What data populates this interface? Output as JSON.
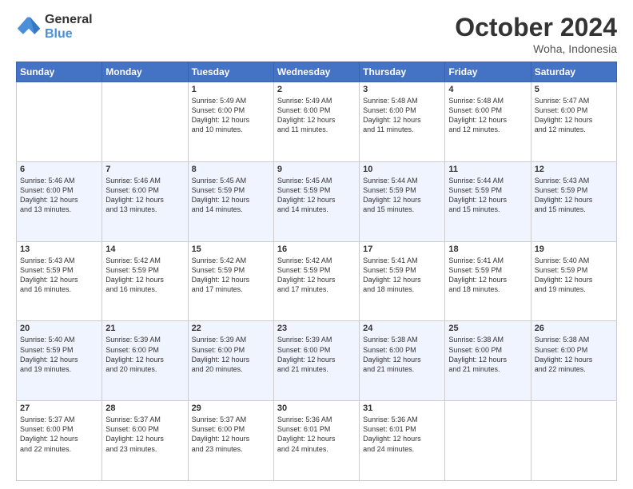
{
  "logo": {
    "general": "General",
    "blue": "Blue"
  },
  "header": {
    "month": "October 2024",
    "location": "Woha, Indonesia"
  },
  "days": [
    "Sunday",
    "Monday",
    "Tuesday",
    "Wednesday",
    "Thursday",
    "Friday",
    "Saturday"
  ],
  "weeks": [
    [
      {
        "day": "",
        "lines": []
      },
      {
        "day": "",
        "lines": []
      },
      {
        "day": "1",
        "lines": [
          "Sunrise: 5:49 AM",
          "Sunset: 6:00 PM",
          "Daylight: 12 hours",
          "and 10 minutes."
        ]
      },
      {
        "day": "2",
        "lines": [
          "Sunrise: 5:49 AM",
          "Sunset: 6:00 PM",
          "Daylight: 12 hours",
          "and 11 minutes."
        ]
      },
      {
        "day": "3",
        "lines": [
          "Sunrise: 5:48 AM",
          "Sunset: 6:00 PM",
          "Daylight: 12 hours",
          "and 11 minutes."
        ]
      },
      {
        "day": "4",
        "lines": [
          "Sunrise: 5:48 AM",
          "Sunset: 6:00 PM",
          "Daylight: 12 hours",
          "and 12 minutes."
        ]
      },
      {
        "day": "5",
        "lines": [
          "Sunrise: 5:47 AM",
          "Sunset: 6:00 PM",
          "Daylight: 12 hours",
          "and 12 minutes."
        ]
      }
    ],
    [
      {
        "day": "6",
        "lines": [
          "Sunrise: 5:46 AM",
          "Sunset: 6:00 PM",
          "Daylight: 12 hours",
          "and 13 minutes."
        ]
      },
      {
        "day": "7",
        "lines": [
          "Sunrise: 5:46 AM",
          "Sunset: 6:00 PM",
          "Daylight: 12 hours",
          "and 13 minutes."
        ]
      },
      {
        "day": "8",
        "lines": [
          "Sunrise: 5:45 AM",
          "Sunset: 5:59 PM",
          "Daylight: 12 hours",
          "and 14 minutes."
        ]
      },
      {
        "day": "9",
        "lines": [
          "Sunrise: 5:45 AM",
          "Sunset: 5:59 PM",
          "Daylight: 12 hours",
          "and 14 minutes."
        ]
      },
      {
        "day": "10",
        "lines": [
          "Sunrise: 5:44 AM",
          "Sunset: 5:59 PM",
          "Daylight: 12 hours",
          "and 15 minutes."
        ]
      },
      {
        "day": "11",
        "lines": [
          "Sunrise: 5:44 AM",
          "Sunset: 5:59 PM",
          "Daylight: 12 hours",
          "and 15 minutes."
        ]
      },
      {
        "day": "12",
        "lines": [
          "Sunrise: 5:43 AM",
          "Sunset: 5:59 PM",
          "Daylight: 12 hours",
          "and 15 minutes."
        ]
      }
    ],
    [
      {
        "day": "13",
        "lines": [
          "Sunrise: 5:43 AM",
          "Sunset: 5:59 PM",
          "Daylight: 12 hours",
          "and 16 minutes."
        ]
      },
      {
        "day": "14",
        "lines": [
          "Sunrise: 5:42 AM",
          "Sunset: 5:59 PM",
          "Daylight: 12 hours",
          "and 16 minutes."
        ]
      },
      {
        "day": "15",
        "lines": [
          "Sunrise: 5:42 AM",
          "Sunset: 5:59 PM",
          "Daylight: 12 hours",
          "and 17 minutes."
        ]
      },
      {
        "day": "16",
        "lines": [
          "Sunrise: 5:42 AM",
          "Sunset: 5:59 PM",
          "Daylight: 12 hours",
          "and 17 minutes."
        ]
      },
      {
        "day": "17",
        "lines": [
          "Sunrise: 5:41 AM",
          "Sunset: 5:59 PM",
          "Daylight: 12 hours",
          "and 18 minutes."
        ]
      },
      {
        "day": "18",
        "lines": [
          "Sunrise: 5:41 AM",
          "Sunset: 5:59 PM",
          "Daylight: 12 hours",
          "and 18 minutes."
        ]
      },
      {
        "day": "19",
        "lines": [
          "Sunrise: 5:40 AM",
          "Sunset: 5:59 PM",
          "Daylight: 12 hours",
          "and 19 minutes."
        ]
      }
    ],
    [
      {
        "day": "20",
        "lines": [
          "Sunrise: 5:40 AM",
          "Sunset: 5:59 PM",
          "Daylight: 12 hours",
          "and 19 minutes."
        ]
      },
      {
        "day": "21",
        "lines": [
          "Sunrise: 5:39 AM",
          "Sunset: 6:00 PM",
          "Daylight: 12 hours",
          "and 20 minutes."
        ]
      },
      {
        "day": "22",
        "lines": [
          "Sunrise: 5:39 AM",
          "Sunset: 6:00 PM",
          "Daylight: 12 hours",
          "and 20 minutes."
        ]
      },
      {
        "day": "23",
        "lines": [
          "Sunrise: 5:39 AM",
          "Sunset: 6:00 PM",
          "Daylight: 12 hours",
          "and 21 minutes."
        ]
      },
      {
        "day": "24",
        "lines": [
          "Sunrise: 5:38 AM",
          "Sunset: 6:00 PM",
          "Daylight: 12 hours",
          "and 21 minutes."
        ]
      },
      {
        "day": "25",
        "lines": [
          "Sunrise: 5:38 AM",
          "Sunset: 6:00 PM",
          "Daylight: 12 hours",
          "and 21 minutes."
        ]
      },
      {
        "day": "26",
        "lines": [
          "Sunrise: 5:38 AM",
          "Sunset: 6:00 PM",
          "Daylight: 12 hours",
          "and 22 minutes."
        ]
      }
    ],
    [
      {
        "day": "27",
        "lines": [
          "Sunrise: 5:37 AM",
          "Sunset: 6:00 PM",
          "Daylight: 12 hours",
          "and 22 minutes."
        ]
      },
      {
        "day": "28",
        "lines": [
          "Sunrise: 5:37 AM",
          "Sunset: 6:00 PM",
          "Daylight: 12 hours",
          "and 23 minutes."
        ]
      },
      {
        "day": "29",
        "lines": [
          "Sunrise: 5:37 AM",
          "Sunset: 6:00 PM",
          "Daylight: 12 hours",
          "and 23 minutes."
        ]
      },
      {
        "day": "30",
        "lines": [
          "Sunrise: 5:36 AM",
          "Sunset: 6:01 PM",
          "Daylight: 12 hours",
          "and 24 minutes."
        ]
      },
      {
        "day": "31",
        "lines": [
          "Sunrise: 5:36 AM",
          "Sunset: 6:01 PM",
          "Daylight: 12 hours",
          "and 24 minutes."
        ]
      },
      {
        "day": "",
        "lines": []
      },
      {
        "day": "",
        "lines": []
      }
    ]
  ]
}
